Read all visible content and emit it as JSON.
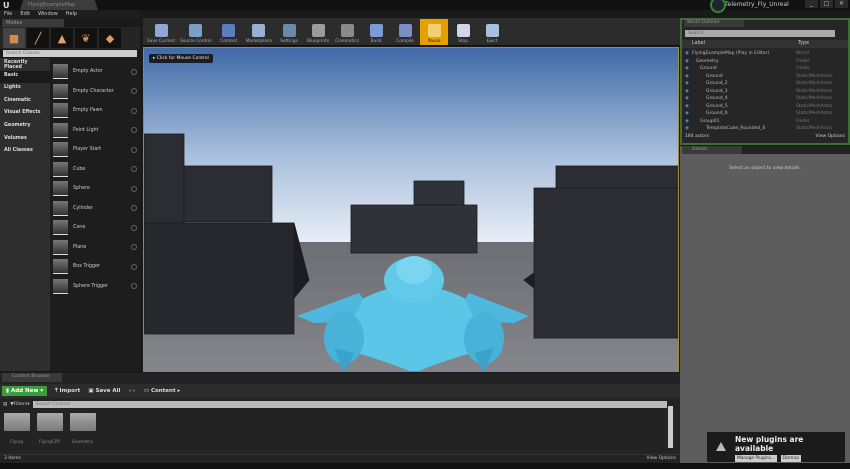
{
  "window": {
    "tab": "FlyingExampleMap",
    "project": "Telemetry_Fly_Unreal",
    "controls": [
      "_",
      "□",
      "✕"
    ]
  },
  "menu": [
    "File",
    "Edit",
    "Window",
    "Help"
  ],
  "modes": {
    "tab": "Modes",
    "search_placeholder": "Search Classes",
    "icons": [
      "place-icon",
      "paint-icon",
      "landscape-icon",
      "foliage-icon",
      "geometry-icon"
    ],
    "categories": [
      "Recently Placed",
      "Basic",
      "Lights",
      "Cinematic",
      "Visual Effects",
      "Geometry",
      "Volumes",
      "All Classes"
    ],
    "active_category": "Basic",
    "items": [
      "Empty Actor",
      "Empty Character",
      "Empty Pawn",
      "Point Light",
      "Player Start",
      "Cube",
      "Sphere",
      "Cylinder",
      "Cone",
      "Plane",
      "Box Trigger",
      "Sphere Trigger"
    ]
  },
  "toolbar": [
    {
      "label": "Save Current",
      "color": "#8fa6d8"
    },
    {
      "label": "Source Control",
      "color": "#7aa0c8"
    },
    {
      "label": "Content",
      "color": "#5a7fc0"
    },
    {
      "label": "Marketplace",
      "color": "#9ab0d0"
    },
    {
      "label": "Settings",
      "color": "#6a8aa8"
    },
    {
      "label": "Blueprints",
      "color": "#9a9aa0"
    },
    {
      "label": "Cinematics",
      "color": "#8a8a8a"
    },
    {
      "label": "Build",
      "color": "#7a9ad8"
    },
    {
      "label": "Compile",
      "color": "#7a8ec8"
    },
    {
      "label": "Pause",
      "color": "#f0d070",
      "active": true
    },
    {
      "label": "Stop",
      "color": "#d0d8e8"
    },
    {
      "label": "Eject",
      "color": "#a8c0e0"
    }
  ],
  "viewport": {
    "hint": "Click for Mouse Control"
  },
  "outliner": {
    "tab": "World Outliner",
    "search_placeholder": "Search",
    "col_label": "Label",
    "col_type": "Type",
    "rows": [
      [
        "FlyingExampleMap (Play in Editor)",
        "World"
      ],
      [
        "Geometry",
        "Folder"
      ],
      [
        "Ground",
        "Folder"
      ],
      [
        "Ground",
        "StaticMeshActor"
      ],
      [
        "Ground_2",
        "StaticMeshActor"
      ],
      [
        "Ground_3",
        "StaticMeshActor"
      ],
      [
        "Ground_4",
        "StaticMeshActor"
      ],
      [
        "Ground_5",
        "StaticMeshActor"
      ],
      [
        "Ground_6",
        "StaticMeshActor"
      ],
      [
        "Group01",
        "Folder"
      ],
      [
        "TemplateCube_Rounded_6",
        "StaticMeshActor"
      ]
    ],
    "count": "184 actors",
    "view_options": "View Options"
  },
  "details": {
    "tab": "Details",
    "message": "Select an object to view details."
  },
  "content_browser": {
    "tab": "Content Browser",
    "add_new": "Add New",
    "import": "Import",
    "save_all": "Save All",
    "path": "Content",
    "filters": "Filters",
    "search_placeholder": "Search Content",
    "folders": [
      "Flying",
      "FlyingCPP",
      "Geometry"
    ],
    "status": "3 items",
    "view_options": "View Options"
  },
  "notification": {
    "title": "New plugins are available",
    "manage": "Manage Plugins...",
    "dismiss": "Dismiss"
  }
}
